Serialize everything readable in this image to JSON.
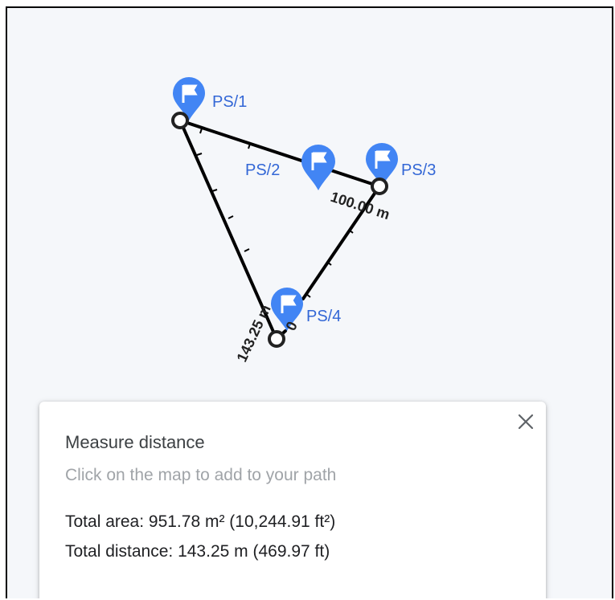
{
  "markers": [
    {
      "label": "PS/1"
    },
    {
      "label": "PS/2"
    },
    {
      "label": "PS/3"
    },
    {
      "label": "PS/4"
    }
  ],
  "segment_labels": {
    "ps3_label": "100.00 m",
    "ps4_label": "143.25 m",
    "zero_label": "0"
  },
  "panel": {
    "title": "Measure distance",
    "hint": "Click on the map to add to your path",
    "total_area": "Total area: 951.78 m² (10,244.91 ft²)",
    "total_distance": "Total distance: 143.25 m (469.97 ft)"
  },
  "colors": {
    "marker": "#4285f4",
    "marker_label": "#3367d6",
    "path": "#000000"
  },
  "icons": {
    "marker": "flag-pin-icon",
    "close": "close-icon"
  }
}
